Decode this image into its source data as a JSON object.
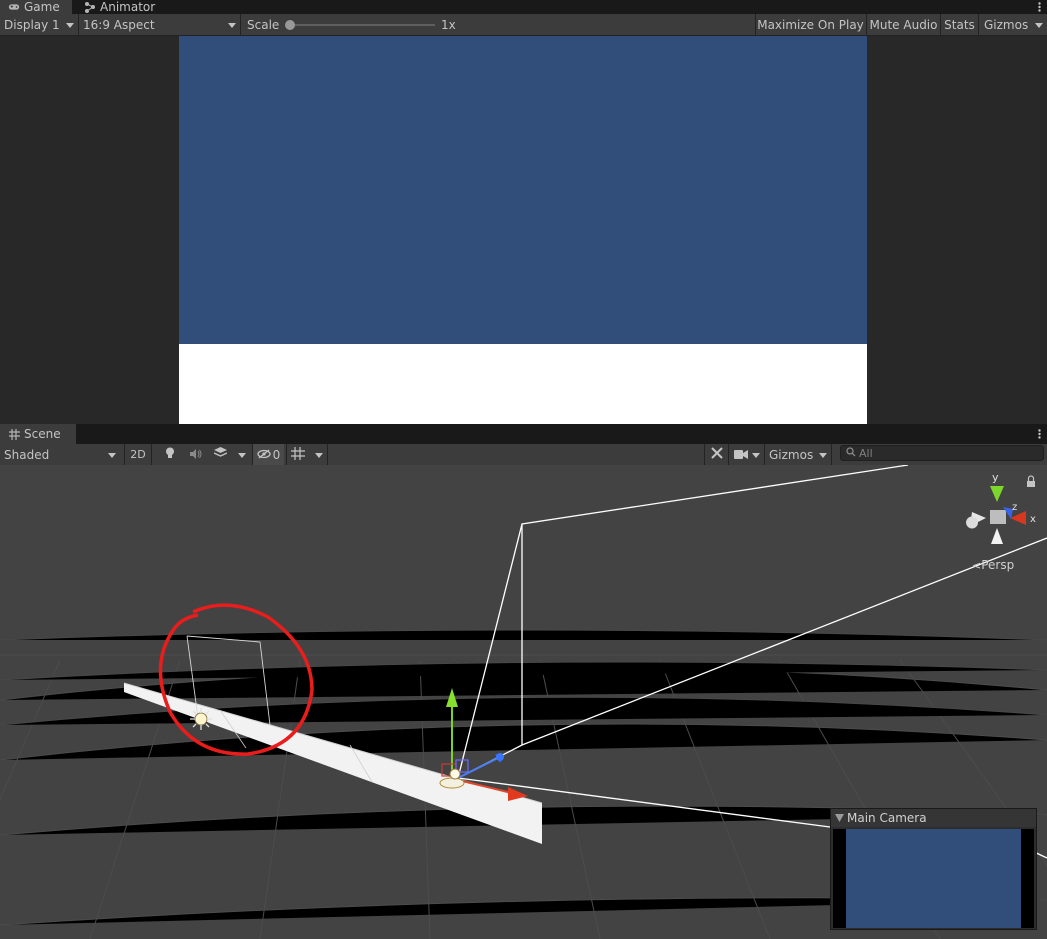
{
  "game_panel": {
    "tabs": [
      {
        "label": "Game",
        "icon": "gamepad-icon",
        "active": true
      },
      {
        "label": "Animator",
        "icon": "animator-icon",
        "active": false
      }
    ],
    "toolbar": {
      "display": "Display 1",
      "aspect": "16:9 Aspect",
      "scale_label": "Scale",
      "scale_value": "1x",
      "maximize_on_play": "Maximize On Play",
      "mute_audio": "Mute Audio",
      "stats": "Stats",
      "gizmos": "Gizmos"
    },
    "colors": {
      "sky": "#314d79",
      "ground": "#ffffff"
    }
  },
  "scene_panel": {
    "tab": {
      "label": "Scene",
      "icon": "grid-icon"
    },
    "toolbar": {
      "shading_mode": "Shaded",
      "toggle_2d": "2D",
      "hidden_count": "0",
      "gizmos": "Gizmos",
      "search_placeholder": "All"
    },
    "view_gizmo": {
      "axis_y": "y",
      "axis_z": "z",
      "axis_x": "x",
      "projection": "Persp"
    },
    "camera_preview": {
      "title": "Main Camera"
    }
  }
}
